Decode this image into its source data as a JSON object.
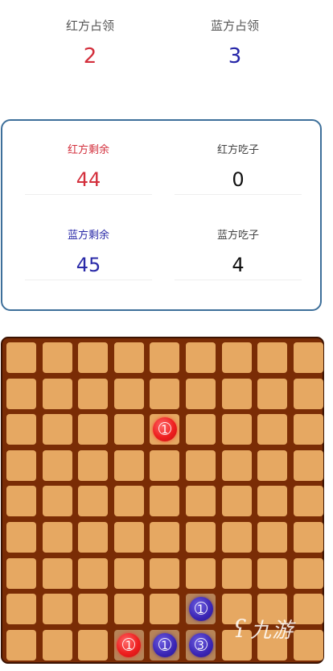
{
  "occupy": {
    "red": {
      "label": "红方占领",
      "value": "2"
    },
    "blue": {
      "label": "蓝方占领",
      "value": "3"
    }
  },
  "stats": {
    "red_remaining": {
      "label": "红方剩余",
      "value": "44"
    },
    "red_captured": {
      "label": "红方吃子",
      "value": "0"
    },
    "blue_remaining": {
      "label": "蓝方剩余",
      "value": "45"
    },
    "blue_captured": {
      "label": "蓝方吃子",
      "value": "4"
    }
  },
  "board": {
    "rows": 9,
    "cols": 9,
    "colors": {
      "tile": "#e6a862",
      "grid": "#7a2c05",
      "red": "#ee1f1f",
      "blue": "#3a25b4"
    },
    "highlighted_tiles": [
      [
        8,
        3
      ],
      [
        8,
        4
      ],
      [
        8,
        5
      ],
      [
        7,
        5
      ]
    ],
    "pieces": [
      {
        "color": "red",
        "row": 2,
        "col": 4,
        "count": "1"
      },
      {
        "color": "blue",
        "row": 7,
        "col": 5,
        "count": "1"
      },
      {
        "color": "red",
        "row": 8,
        "col": 3,
        "count": "1"
      },
      {
        "color": "blue",
        "row": 8,
        "col": 4,
        "count": "1"
      },
      {
        "color": "blue",
        "row": 8,
        "col": 5,
        "count": "3"
      }
    ]
  },
  "watermark": {
    "logo": "ʕ",
    "text": "九游"
  }
}
